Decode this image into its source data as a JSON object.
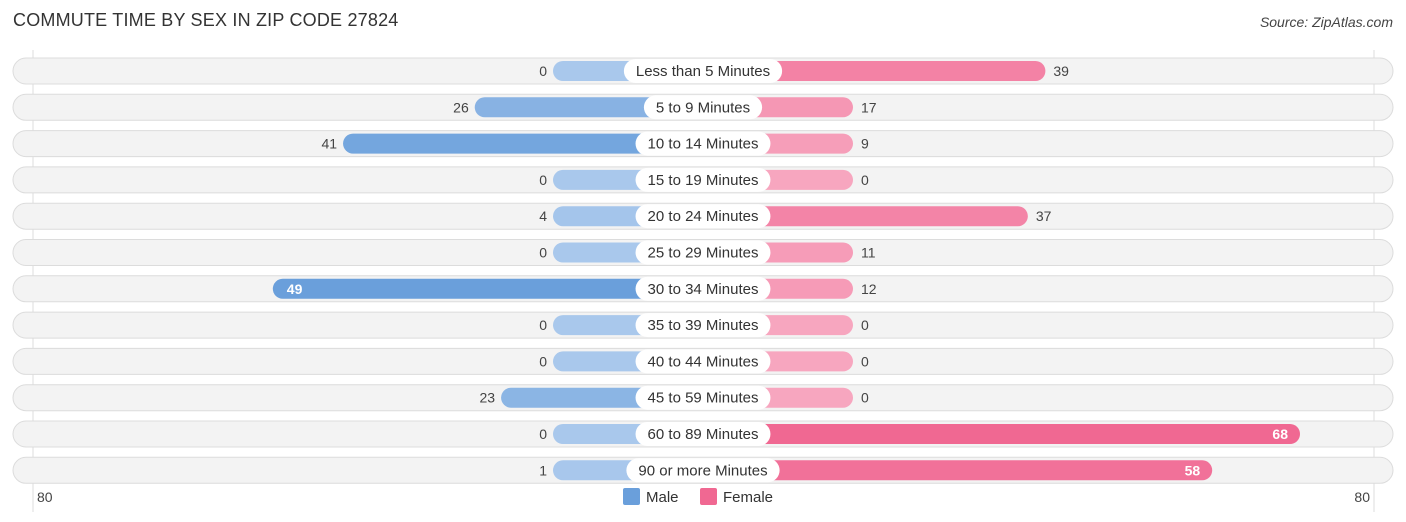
{
  "header": {
    "title": "COMMUTE TIME BY SEX IN ZIP CODE 27824",
    "source": "Source: ZipAtlas.com"
  },
  "colors": {
    "male": "#6a9fdb",
    "male_light": "#a9c8ec",
    "female": "#f06892",
    "female_light": "#f7a6bf"
  },
  "chart_data": {
    "type": "bar",
    "orientation": "horizontal-diverging",
    "title": "COMMUTE TIME BY SEX IN ZIP CODE 27824",
    "xlabel": "",
    "ylabel": "",
    "xlim": [
      -80,
      80
    ],
    "axis_tick_labels": {
      "left": "80",
      "right": "80"
    },
    "legend": {
      "position": "bottom-center",
      "entries": [
        "Male",
        "Female"
      ]
    },
    "categories": [
      "Less than 5 Minutes",
      "5 to 9 Minutes",
      "10 to 14 Minutes",
      "15 to 19 Minutes",
      "20 to 24 Minutes",
      "25 to 29 Minutes",
      "30 to 34 Minutes",
      "35 to 39 Minutes",
      "40 to 44 Minutes",
      "45 to 59 Minutes",
      "60 to 89 Minutes",
      "90 or more Minutes"
    ],
    "series": [
      {
        "name": "Male",
        "side": "left",
        "values": [
          0,
          26,
          41,
          0,
          4,
          0,
          49,
          0,
          0,
          23,
          0,
          1
        ]
      },
      {
        "name": "Female",
        "side": "right",
        "values": [
          39,
          17,
          9,
          0,
          37,
          11,
          12,
          0,
          0,
          0,
          68,
          58
        ]
      }
    ]
  }
}
